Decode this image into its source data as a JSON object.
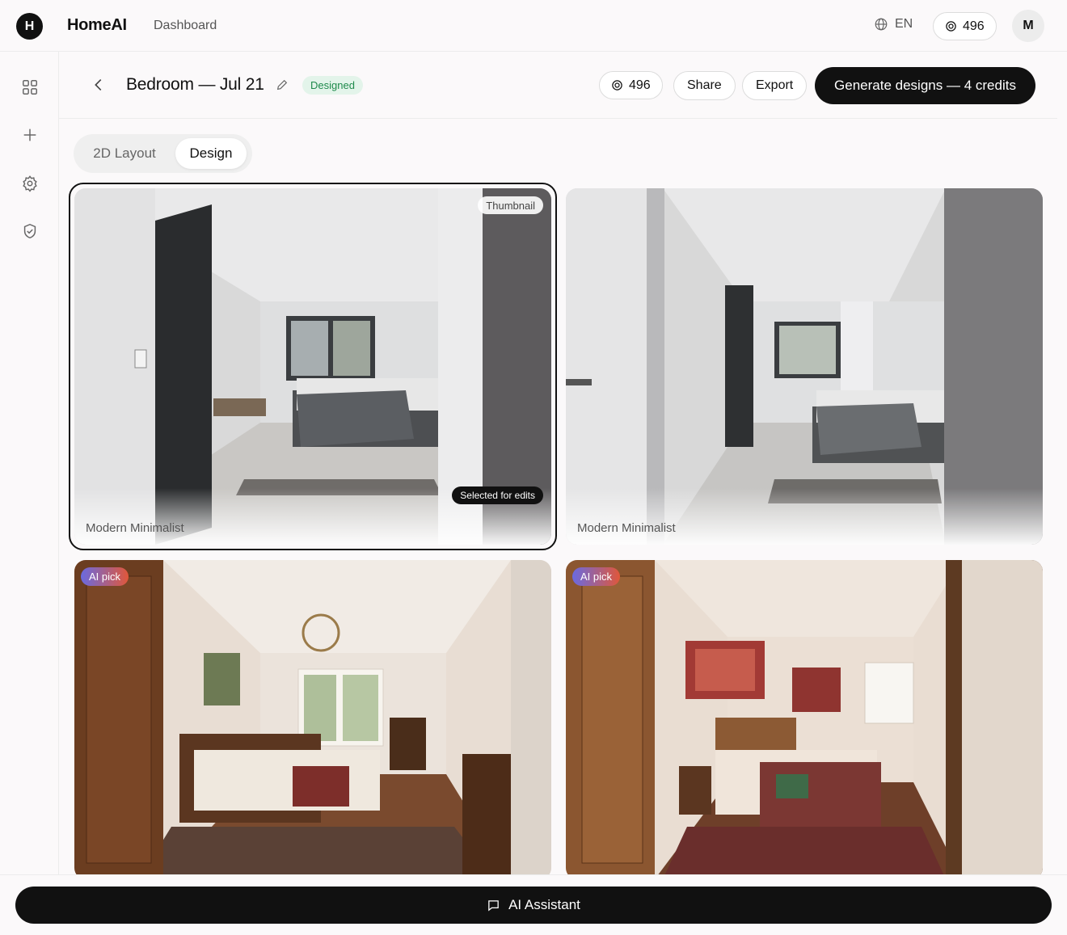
{
  "app": {
    "logo_letter": "H",
    "brand": "HomeAI",
    "nav_dashboard": "Dashboard",
    "language": "EN",
    "credits": "496",
    "avatar_initial": "M"
  },
  "sidebar": {
    "items": [
      {
        "icon": "grid-icon"
      },
      {
        "icon": "plus-icon"
      },
      {
        "icon": "gear-icon"
      },
      {
        "icon": "shield-check-icon"
      }
    ]
  },
  "project": {
    "title": "Bedroom — Jul 21",
    "status": "Designed",
    "credits": "496",
    "share_label": "Share",
    "export_label": "Export",
    "generate_label": "Generate designs — 4 credits"
  },
  "tabs": [
    "2D Layout",
    "Design"
  ],
  "active_tab": "Design",
  "designs": [
    {
      "style": "Modern Minimalist",
      "thumbnail_tag": "Thumbnail",
      "selected_tag": "Selected for edits"
    },
    {
      "style": "Modern Minimalist"
    },
    {
      "ai_tag": "AI pick"
    },
    {
      "ai_tag": "AI pick"
    }
  ],
  "assistant": {
    "label": "AI Assistant"
  },
  "colors": {
    "accent": "#111111",
    "badge_bg": "#e3f4ea",
    "badge_text": "#1f8a4c"
  }
}
